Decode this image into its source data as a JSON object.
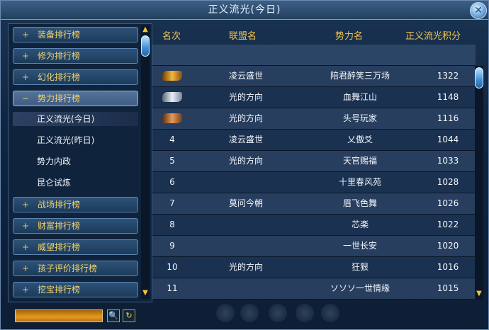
{
  "window": {
    "title": "正义流光(今日)",
    "close_glyph": "✕"
  },
  "nav": {
    "items": [
      {
        "symbol": "+",
        "label": "装备排行榜"
      },
      {
        "symbol": "+",
        "label": "修为排行榜"
      },
      {
        "symbol": "+",
        "label": "幻化排行榜"
      },
      {
        "symbol": "−",
        "label": "势力排行榜"
      },
      {
        "symbol": "+",
        "label": "战场排行榜"
      },
      {
        "symbol": "+",
        "label": "财富排行榜"
      },
      {
        "symbol": "+",
        "label": "威望排行榜"
      },
      {
        "symbol": "+",
        "label": "孩子评价排行榜"
      },
      {
        "symbol": "+",
        "label": "挖宝排行榜"
      }
    ],
    "subitems": [
      {
        "label": "正义流光(今日)"
      },
      {
        "label": "正义流光(昨日)"
      },
      {
        "label": "势力内政"
      },
      {
        "label": "昆仑试炼"
      }
    ]
  },
  "table": {
    "headers": {
      "rank": "名次",
      "alliance": "联盟名",
      "force": "势力名",
      "score": "正义流光积分"
    },
    "rows": [
      {
        "rank": "",
        "medal": "gold",
        "alliance": "凌云盛世",
        "force": "陪君醉笑三万场",
        "score": "1322"
      },
      {
        "rank": "",
        "medal": "silver",
        "alliance": "光的方向",
        "force": "血舞江山",
        "score": "1148"
      },
      {
        "rank": "",
        "medal": "bronze",
        "alliance": "光的方向",
        "force": "头号玩家",
        "score": "1116"
      },
      {
        "rank": "4",
        "medal": "",
        "alliance": "凌云盛世",
        "force": "乂傲爻",
        "score": "1044"
      },
      {
        "rank": "5",
        "medal": "",
        "alliance": "光的方向",
        "force": "天官赐福",
        "score": "1033"
      },
      {
        "rank": "6",
        "medal": "",
        "alliance": "",
        "force": "十里春风苑",
        "score": "1028"
      },
      {
        "rank": "7",
        "medal": "",
        "alliance": "莫问今朝",
        "force": "眉飞色舞",
        "score": "1026"
      },
      {
        "rank": "8",
        "medal": "",
        "alliance": "",
        "force": "芯楽",
        "score": "1022"
      },
      {
        "rank": "9",
        "medal": "",
        "alliance": "",
        "force": "一世长安",
        "score": "1020"
      },
      {
        "rank": "10",
        "medal": "",
        "alliance": "光的方向",
        "force": "狂狠",
        "score": "1016"
      },
      {
        "rank": "11",
        "medal": "",
        "alliance": "",
        "force": "ソソソ一世情缘",
        "score": "1015"
      }
    ]
  },
  "scroll": {
    "up_glyph": "▲",
    "down_glyph": "▼"
  },
  "bottom": {
    "search_glyph": "🔍",
    "refresh_glyph": "↻"
  }
}
